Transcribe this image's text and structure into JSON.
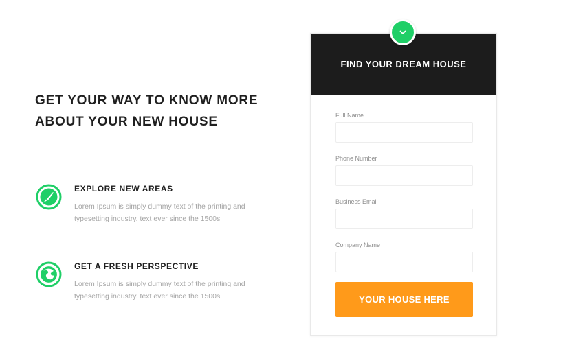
{
  "intro": {
    "headline_line1": "GET YOUR WAY TO KNOW MORE",
    "headline_line2": "ABOUT YOUR NEW HOUSE"
  },
  "features": [
    {
      "icon": "compass-icon",
      "title": "EXPLORE NEW AREAS",
      "description": "Lorem Ipsum is simply dummy text of the printing and typesetting industry. text ever since the 1500s"
    },
    {
      "icon": "globe-icon",
      "title": "GET A FRESH PERSPECTIVE",
      "description": "Lorem Ipsum is simply dummy text of the printing and typesetting industry. text ever since the 1500s"
    }
  ],
  "form": {
    "title": "FIND YOUR DREAM HOUSE",
    "toggle_icon": "chevron-down-icon",
    "fields": [
      {
        "label": "Full Name",
        "value": "",
        "placeholder": ""
      },
      {
        "label": "Phone Number",
        "value": "",
        "placeholder": ""
      },
      {
        "label": "Business Email",
        "value": "",
        "placeholder": ""
      },
      {
        "label": "Company Name",
        "value": "",
        "placeholder": ""
      }
    ],
    "submit_label": "YOUR HOUSE HERE"
  },
  "colors": {
    "accent_green": "#1fcf67",
    "header_dark": "#1c1c1c",
    "button_orange": "#ff9a1a",
    "heading_text": "#1f1f1f",
    "muted_text": "#a5a5a5"
  }
}
